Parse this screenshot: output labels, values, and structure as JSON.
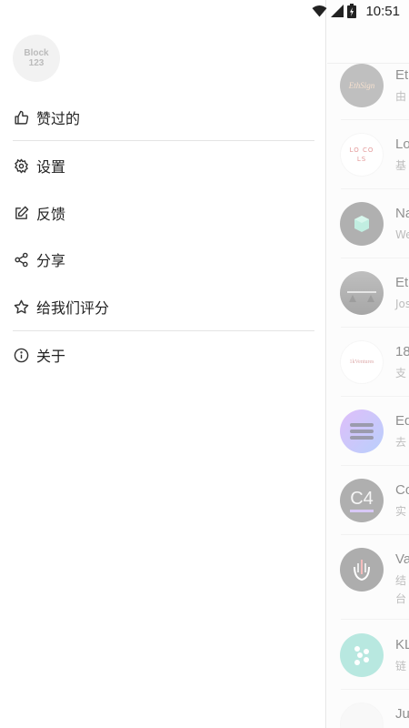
{
  "status_bar": {
    "time": "10:51"
  },
  "drawer": {
    "logo_lines": [
      "Block",
      "123"
    ],
    "menu": [
      {
        "label": "赞过的",
        "icon": "thumbs-up-icon"
      },
      {
        "label": "设置",
        "icon": "gear-icon"
      },
      {
        "label": "反馈",
        "icon": "edit-icon"
      },
      {
        "label": "分享",
        "icon": "share-icon"
      },
      {
        "label": "给我们评分",
        "icon": "star-icon"
      },
      {
        "label": "关于",
        "icon": "info-icon"
      }
    ]
  },
  "background_list": [
    {
      "title": "Eth",
      "sub": [
        "由"
      ],
      "avatar_text": "EthSign",
      "avatar_color": "#8a8a8a"
    },
    {
      "title": "Lo",
      "sub": [
        "基"
      ],
      "avatar_text": "LO CO LS",
      "avatar_color": "#ffffff"
    },
    {
      "title": "Na",
      "sub": [
        "We"
      ],
      "avatar_text": "",
      "avatar_color": "#6f6f6f"
    },
    {
      "title": "Eth",
      "sub": [
        "Jos"
      ],
      "avatar_text": "",
      "avatar_color": "#7a7a7a"
    },
    {
      "title": "18",
      "sub": [
        "支"
      ],
      "avatar_text": "1kVentures",
      "avatar_color": "#ffffff"
    },
    {
      "title": "Eq",
      "sub": [
        "去"
      ],
      "avatar_text": "",
      "avatar_color": "#9b8cf0"
    },
    {
      "title": "Co",
      "sub": [
        "实"
      ],
      "avatar_text": "C4",
      "avatar_color": "#6d6d6d"
    },
    {
      "title": "Va",
      "sub": [
        "结",
        "台"
      ],
      "avatar_text": "",
      "avatar_color": "#6a6a6a"
    },
    {
      "title": "KL",
      "sub": [
        "链"
      ],
      "avatar_text": "",
      "avatar_color": "#7fd6c6"
    },
    {
      "title": "Ju",
      "sub": [],
      "avatar_text": "",
      "avatar_color": "#f3f3f3"
    }
  ]
}
